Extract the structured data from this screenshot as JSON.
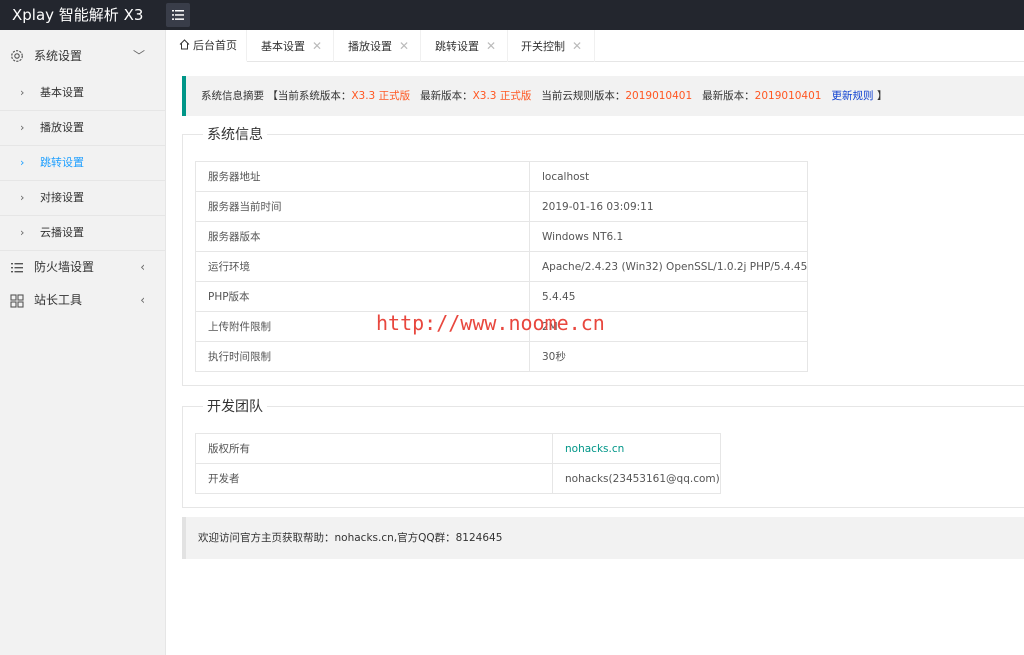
{
  "app": {
    "title": "Xplay 智能解析 X3"
  },
  "sidebar": {
    "groups": [
      {
        "label": "系统设置",
        "icon": "gear-icon",
        "arrow": "﹀"
      },
      {
        "label": "防火墙设置",
        "icon": "list-icon",
        "arrow": "‹"
      },
      {
        "label": "站长工具",
        "icon": "grid-icon",
        "arrow": "‹"
      }
    ],
    "items": [
      {
        "label": "基本设置"
      },
      {
        "label": "播放设置"
      },
      {
        "label": "跳转设置",
        "active": true
      },
      {
        "label": "对接设置"
      },
      {
        "label": "云播设置"
      }
    ]
  },
  "tabs": [
    {
      "label": "后台首页",
      "active": true
    },
    {
      "label": "基本设置"
    },
    {
      "label": "播放设置"
    },
    {
      "label": "跳转设置"
    },
    {
      "label": "开关控制"
    }
  ],
  "notice": {
    "prefix": "系统信息摘要 【当前系统版本：",
    "current_version": "X3.3 正式版",
    "latest_label": "最新版本：",
    "latest_version": "X3.3 正式版",
    "rule_label": "当前云规则版本：",
    "rule_version": "2019010401",
    "rule_latest_label": "最新版本：",
    "rule_latest_version": "2019010401",
    "update_link": "更新规则",
    "suffix": "】"
  },
  "system_info": {
    "title": "系统信息",
    "rows": [
      {
        "key": "服务器地址",
        "value": "localhost"
      },
      {
        "key": "服务器当前时间",
        "value": "2019-01-16 03:09:11"
      },
      {
        "key": "服务器版本",
        "value": "Windows NT6.1"
      },
      {
        "key": "运行环境",
        "value": "Apache/2.4.23 (Win32) OpenSSL/1.0.2j PHP/5.4.45"
      },
      {
        "key": "PHP版本",
        "value": "5.4.45"
      },
      {
        "key": "上传附件限制",
        "value": "2M"
      },
      {
        "key": "执行时间限制",
        "value": "30秒"
      }
    ]
  },
  "dev_team": {
    "title": "开发团队",
    "rows": [
      {
        "key": "版权所有",
        "value": "nohacks.cn"
      },
      {
        "key": "开发者",
        "value": "nohacks(23453161@qq.com)"
      }
    ]
  },
  "footer_note": "欢迎访问官方主页获取帮助：nohacks.cn,官方QQ群：8124645",
  "watermark": "http://www.noome.cn",
  "colors": {
    "topbar": "#23262e",
    "accent": "#009688",
    "active_blue": "#1e9fff",
    "version_red": "#ff5722"
  }
}
